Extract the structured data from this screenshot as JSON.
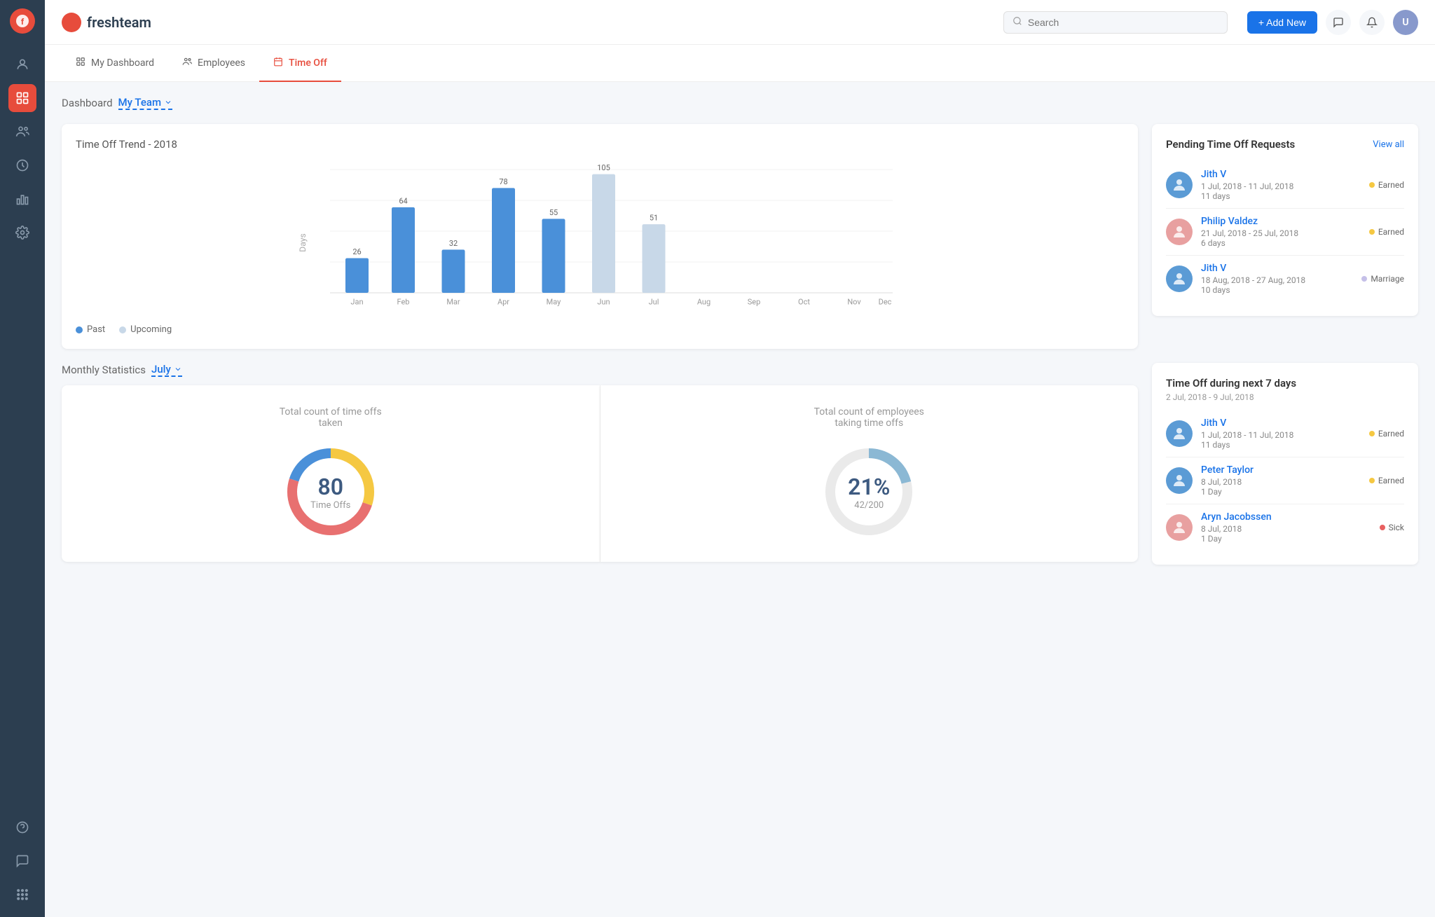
{
  "app": {
    "name": "freshteam",
    "logo_text": "f"
  },
  "topbar": {
    "search_placeholder": "Search",
    "add_new_label": "+ Add New"
  },
  "nav": {
    "tabs": [
      {
        "id": "dashboard",
        "label": "My Dashboard",
        "icon": "grid-icon"
      },
      {
        "id": "employees",
        "label": "Employees",
        "icon": "people-icon"
      },
      {
        "id": "timeoff",
        "label": "Time Off",
        "icon": "calendar-icon",
        "active": true
      }
    ]
  },
  "dashboard": {
    "title": "Dashboard",
    "team_selector": "My Team",
    "chart": {
      "title": "Time Off Trend - 2018",
      "months": [
        "Jan",
        "Feb",
        "Mar",
        "Apr",
        "May",
        "Jun",
        "Jul",
        "Aug",
        "Sep",
        "Oct",
        "Nov",
        "Dec"
      ],
      "past_values": [
        26,
        64,
        32,
        78,
        55,
        0,
        0,
        0,
        0,
        0,
        0,
        0
      ],
      "upcoming_values": [
        0,
        0,
        0,
        0,
        0,
        105,
        51,
        0,
        0,
        0,
        0,
        0
      ],
      "legend_past": "Past",
      "legend_upcoming": "Upcoming"
    }
  },
  "pending_requests": {
    "title": "Pending Time Off Requests",
    "view_all": "View all",
    "items": [
      {
        "name": "Jith V",
        "dates": "1 Jul, 2018 - 11 Jul, 2018",
        "days": "11 days",
        "badge": "Earned",
        "badge_color": "#f5c842",
        "avatar_color": "#8ba7c7"
      },
      {
        "name": "Philip Valdez",
        "dates": "21 Jul, 2018 - 25 Jul, 2018",
        "days": "6 days",
        "badge": "Earned",
        "badge_color": "#f5c842",
        "avatar_color": "#c49a9a"
      },
      {
        "name": "Jith V",
        "dates": "18 Aug, 2018 - 27 Aug, 2018",
        "days": "10 days",
        "badge": "Marriage",
        "badge_color": "#c5c0e8",
        "avatar_color": "#8ba7c7"
      }
    ]
  },
  "monthly_stats": {
    "label": "Monthly Statistics",
    "month": "July",
    "total_timeoffs": {
      "label": "Total count of time offs\ntaken",
      "value": "80",
      "sub": "Time Offs"
    },
    "total_employees": {
      "label": "Total count of employees\ntaking time offs",
      "value": "21%",
      "sub": "42/200"
    }
  },
  "next7days": {
    "title": "Time Off during next 7 days",
    "dates": "2 Jul, 2018 - 9 Jul, 2018",
    "items": [
      {
        "name": "Jith V",
        "dates": "1 Jul, 2018 - 11 Jul, 2018",
        "days": "11 days",
        "badge": "Earned",
        "badge_color": "#f5c842",
        "avatar_color": "#8ba7c7"
      },
      {
        "name": "Peter Taylor",
        "dates": "8 Jul, 2018",
        "days": "1 Day",
        "badge": "Earned",
        "badge_color": "#f5c842",
        "avatar_color": "#8ba7c7"
      },
      {
        "name": "Aryn Jacobssen",
        "dates": "8 Jul, 2018",
        "days": "1 Day",
        "badge": "Sick",
        "badge_color": "#e86060",
        "avatar_color": "#c49a9a"
      }
    ]
  },
  "sidebar": {
    "items": [
      {
        "icon": "👤",
        "active": false
      },
      {
        "icon": "💼",
        "active": false
      },
      {
        "icon": "👥",
        "active": false
      },
      {
        "icon": "⏰",
        "active": false
      },
      {
        "icon": "📊",
        "active": false
      },
      {
        "icon": "⚙️",
        "active": false
      }
    ],
    "bottom_items": [
      {
        "icon": "❓"
      },
      {
        "icon": "💬"
      },
      {
        "icon": "⠿"
      }
    ]
  }
}
